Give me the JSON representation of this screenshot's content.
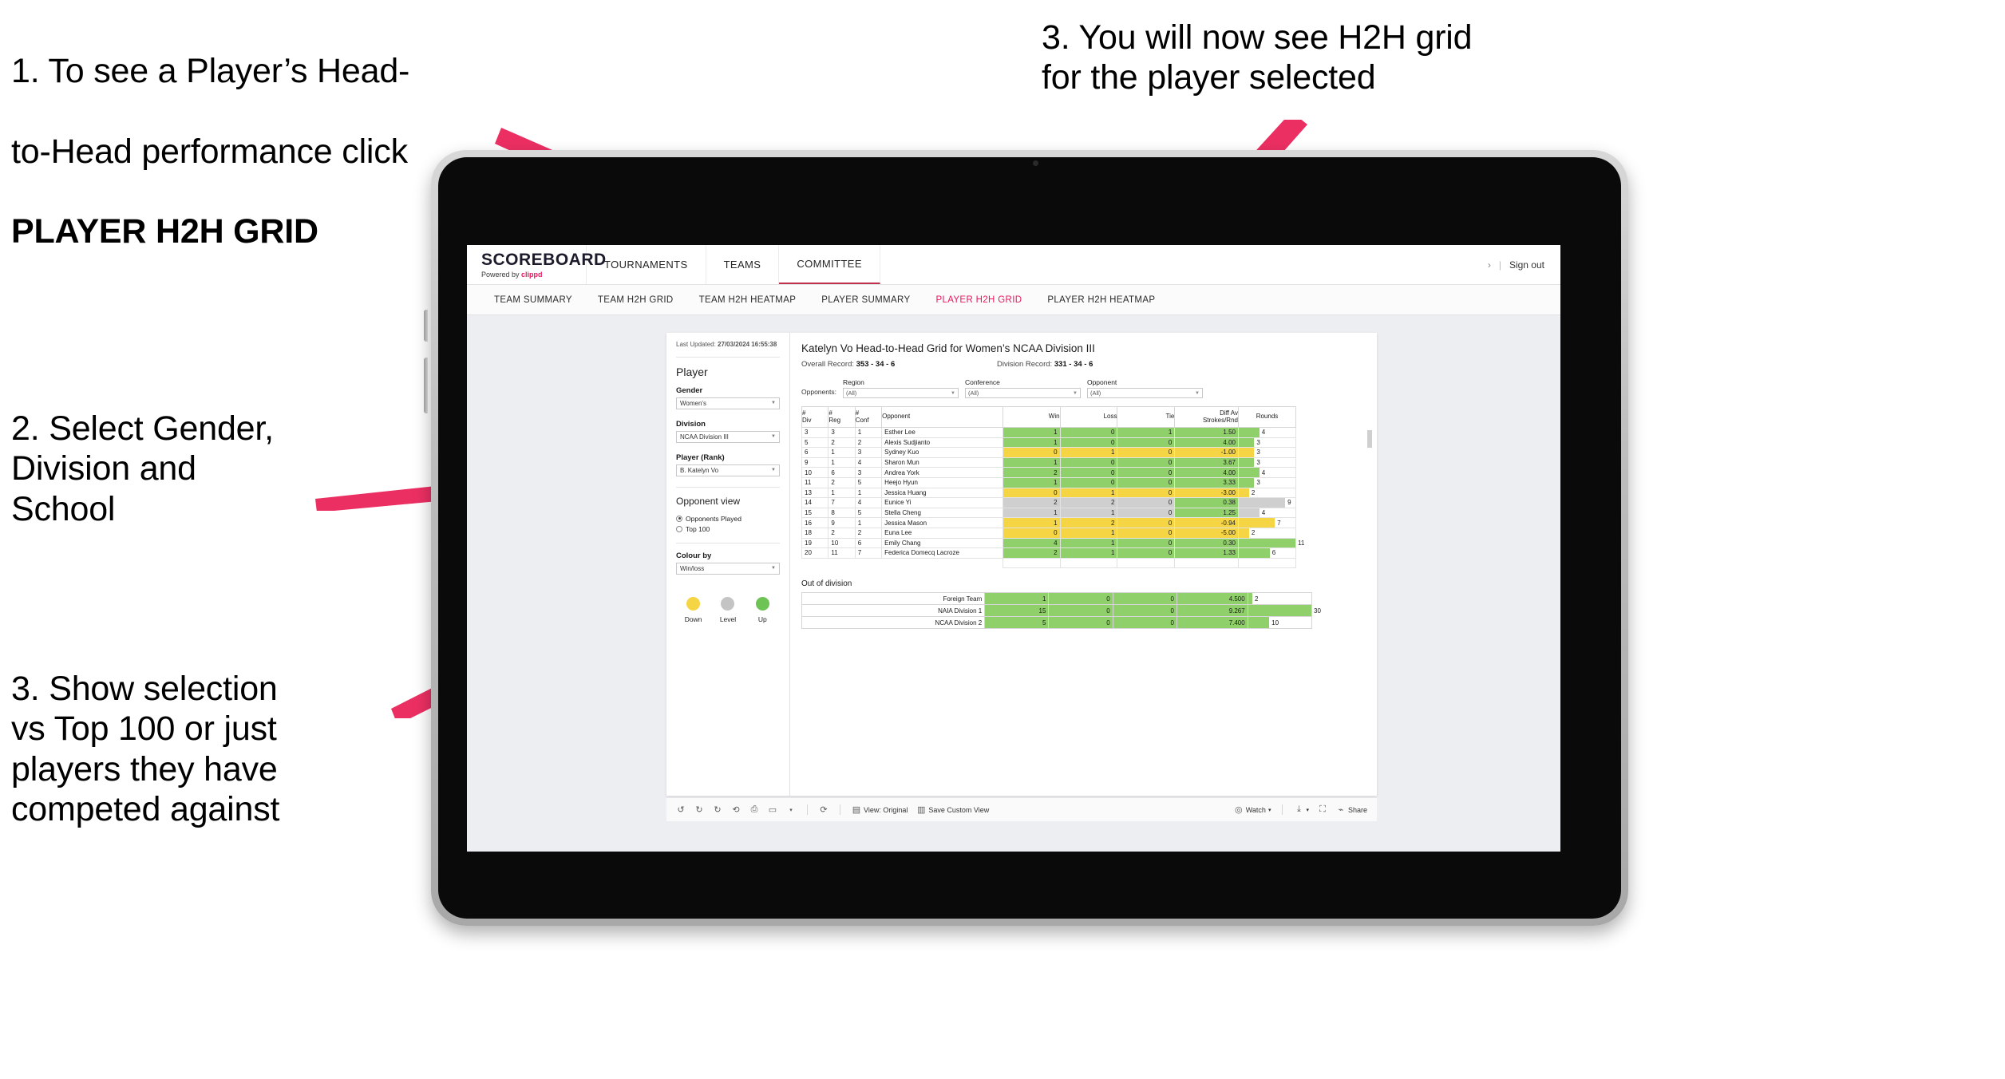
{
  "annotations": {
    "step1_line1": "1. To see a Player’s Head-",
    "step1_line2": "to-Head performance click",
    "step1_bold": "PLAYER H2H GRID",
    "step2": "2. Select Gender,\nDivision and\nSchool",
    "step3": "3. Show selection\nvs Top 100 or just\nplayers they have\ncompeted against",
    "step4": "3. You will now see H2H grid\nfor the player selected",
    "arrow_color": "#ec2f63"
  },
  "topnav": {
    "brand_name": "SCOREBOARD",
    "brand_sub_prefix": "Powered by ",
    "brand_sub_accent": "clippd",
    "items": [
      {
        "label": "TOURNAMENTS",
        "active": false
      },
      {
        "label": "TEAMS",
        "active": false
      },
      {
        "label": "COMMITTEE",
        "active": true
      }
    ],
    "chevron": "›",
    "divider": "|",
    "sign_out": "Sign out"
  },
  "tabs": [
    {
      "label": "TEAM SUMMARY",
      "active": false
    },
    {
      "label": "TEAM H2H GRID",
      "active": false
    },
    {
      "label": "TEAM H2H HEATMAP",
      "active": false
    },
    {
      "label": "PLAYER SUMMARY",
      "active": false
    },
    {
      "label": "PLAYER H2H GRID",
      "active": true
    },
    {
      "label": "PLAYER H2H HEATMAP",
      "active": false
    }
  ],
  "filters": {
    "last_updated_label": "Last Updated: ",
    "last_updated_value": "27/03/2024 16:55:38",
    "section_title": "Player",
    "gender": {
      "label": "Gender",
      "value": "Women's"
    },
    "division": {
      "label": "Division",
      "value": "NCAA Division III"
    },
    "player": {
      "label": "Player (Rank)",
      "value": "B. Katelyn Vo"
    },
    "opponent_view": {
      "label": "Opponent view",
      "options": [
        {
          "label": "Opponents Played",
          "selected": true
        },
        {
          "label": "Top 100",
          "selected": false
        }
      ]
    },
    "colour_by": {
      "label": "Colour by",
      "value": "Win/loss"
    },
    "legend": [
      {
        "label": "Down",
        "color": "#f5d544"
      },
      {
        "label": "Level",
        "color": "#c4c4c4"
      },
      {
        "label": "Up",
        "color": "#6dc354"
      }
    ]
  },
  "viz": {
    "title": "Katelyn Vo Head-to-Head Grid for Women’s NCAA Division III",
    "overall_record_label": "Overall Record: ",
    "overall_record_value": "353 -  34 - 6",
    "division_record_label": "Division Record: ",
    "division_record_value": "331 -  34 - 6",
    "opponents_label": "Opponents:",
    "opponent_filters": [
      {
        "caption": "Region",
        "value": "(All)"
      },
      {
        "caption": "Conference",
        "value": "(All)"
      },
      {
        "caption": "Opponent",
        "value": "(All)"
      }
    ]
  },
  "chart_data": {
    "type": "table",
    "title": "Katelyn Vo Head-to-Head Grid for Women’s NCAA Division III",
    "columns": [
      "# Div",
      "# Reg",
      "# Conf",
      "Opponent",
      "Win",
      "Loss",
      "Tie",
      "Diff Av Strokes/Rnd",
      "Rounds"
    ],
    "header_lines": {
      "div": [
        "#",
        "Div"
      ],
      "reg": [
        "#",
        "Reg"
      ],
      "conf": [
        "#",
        "Conf"
      ],
      "opponent": [
        "Opponent"
      ],
      "win": [
        "Win"
      ],
      "loss": [
        "Loss"
      ],
      "tie": [
        "Tie"
      ],
      "diff": [
        "Diff Av",
        "Strokes/Rnd"
      ],
      "rounds": [
        "Rounds"
      ]
    },
    "rounds_max": 11,
    "rows": [
      {
        "div": "3",
        "reg": "3",
        "conf": "1",
        "opponent": "Esther Lee",
        "win": "1",
        "loss": "0",
        "tie": "1",
        "diff": "1.50",
        "rounds": "4",
        "color": "#8fd06a"
      },
      {
        "div": "5",
        "reg": "2",
        "conf": "2",
        "opponent": "Alexis Sudjianto",
        "win": "1",
        "loss": "0",
        "tie": "0",
        "diff": "4.00",
        "rounds": "3",
        "color": "#8fd06a"
      },
      {
        "div": "6",
        "reg": "1",
        "conf": "3",
        "opponent": "Sydney Kuo",
        "win": "0",
        "loss": "1",
        "tie": "0",
        "diff": "-1.00",
        "rounds": "3",
        "color": "#f5d544"
      },
      {
        "div": "9",
        "reg": "1",
        "conf": "4",
        "opponent": "Sharon Mun",
        "win": "1",
        "loss": "0",
        "tie": "0",
        "diff": "3.67",
        "rounds": "3",
        "color": "#8fd06a"
      },
      {
        "div": "10",
        "reg": "6",
        "conf": "3",
        "opponent": "Andrea York",
        "win": "2",
        "loss": "0",
        "tie": "0",
        "diff": "4.00",
        "rounds": "4",
        "color": "#8fd06a"
      },
      {
        "div": "11",
        "reg": "2",
        "conf": "5",
        "opponent": "Heejo Hyun",
        "win": "1",
        "loss": "0",
        "tie": "0",
        "diff": "3.33",
        "rounds": "3",
        "color": "#8fd06a"
      },
      {
        "div": "13",
        "reg": "1",
        "conf": "1",
        "opponent": "Jessica Huang",
        "win": "0",
        "loss": "1",
        "tie": "0",
        "diff": "-3.00",
        "rounds": "2",
        "color": "#f5d544"
      },
      {
        "div": "14",
        "reg": "7",
        "conf": "4",
        "opponent": "Eunice Yi",
        "win": "2",
        "loss": "2",
        "tie": "0",
        "diff": "0.38",
        "rounds": "9",
        "color": "#cfcfcf",
        "diff_color": "#8fd06a"
      },
      {
        "div": "15",
        "reg": "8",
        "conf": "5",
        "opponent": "Stella Cheng",
        "win": "1",
        "loss": "1",
        "tie": "0",
        "diff": "1.25",
        "rounds": "4",
        "color": "#cfcfcf",
        "diff_color": "#8fd06a"
      },
      {
        "div": "16",
        "reg": "9",
        "conf": "1",
        "opponent": "Jessica Mason",
        "win": "1",
        "loss": "2",
        "tie": "0",
        "diff": "-0.94",
        "rounds": "7",
        "color": "#f5d544"
      },
      {
        "div": "18",
        "reg": "2",
        "conf": "2",
        "opponent": "Euna Lee",
        "win": "0",
        "loss": "1",
        "tie": "0",
        "diff": "-5.00",
        "rounds": "2",
        "color": "#f5d544"
      },
      {
        "div": "19",
        "reg": "10",
        "conf": "6",
        "opponent": "Emily Chang",
        "win": "4",
        "loss": "1",
        "tie": "0",
        "diff": "0.30",
        "rounds": "11",
        "color": "#8fd06a"
      },
      {
        "div": "20",
        "reg": "11",
        "conf": "7",
        "opponent": "Federica Domecq Lacroze",
        "win": "2",
        "loss": "1",
        "tie": "0",
        "diff": "1.33",
        "rounds": "6",
        "color": "#8fd06a"
      }
    ],
    "out_of_division": {
      "title": "Out of division",
      "rounds_max": 30,
      "rows": [
        {
          "name": "Foreign Team",
          "win": "1",
          "loss": "0",
          "tie": "0",
          "diff": "4.500",
          "rounds": "2",
          "color": "#8fd06a"
        },
        {
          "name": "NAIA Division 1",
          "win": "15",
          "loss": "0",
          "tie": "0",
          "diff": "9.267",
          "rounds": "30",
          "color": "#8fd06a"
        },
        {
          "name": "NCAA Division 2",
          "win": "5",
          "loss": "0",
          "tie": "0",
          "diff": "7.400",
          "rounds": "10",
          "color": "#8fd06a"
        }
      ]
    }
  },
  "toolbar": {
    "undo": "↺",
    "redo": "↻",
    "revert": "↻",
    "refresh": "⟳",
    "pause": "⏸",
    "view_original": "View: Original",
    "save_custom_view": "Save Custom View",
    "watch": "Watch",
    "share": "Share",
    "caret": "▾"
  }
}
